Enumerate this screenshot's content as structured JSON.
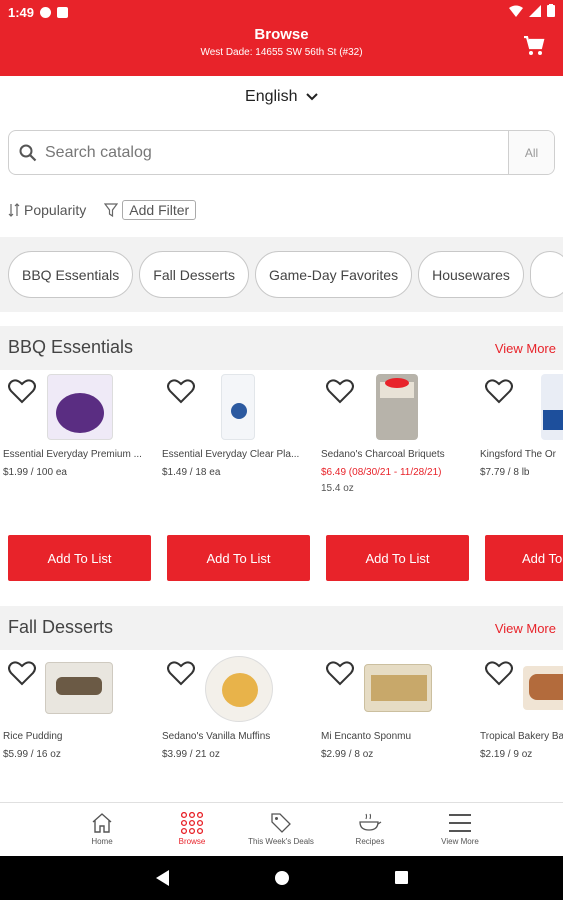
{
  "status": {
    "time": "1:49"
  },
  "header": {
    "title": "Browse",
    "store": "West Dade: 14655 SW 56th St (#32)"
  },
  "language": "English",
  "search": {
    "placeholder": "Search catalog",
    "scope": "All"
  },
  "sort": {
    "label": "Popularity"
  },
  "filter": {
    "label": "Add Filter"
  },
  "categories": [
    "BBQ Essentials",
    "Fall Desserts",
    "Game-Day Favorites",
    "Housewares",
    ""
  ],
  "sections": [
    {
      "title": "BBQ Essentials",
      "view_more": "View More",
      "products": [
        {
          "name": "Essential Everyday Premium ...",
          "price": "$1.99 / 100 ea",
          "extra": "",
          "sale": false,
          "button": "Add To List"
        },
        {
          "name": "Essential Everyday Clear Pla...",
          "price": "$1.49 / 18 ea",
          "extra": "",
          "sale": false,
          "button": "Add To List"
        },
        {
          "name": "Sedano's Charcoal Briquets",
          "price": "$6.49 (08/30/21 - 11/28/21)",
          "extra": "15.4 oz",
          "sale": true,
          "button": "Add To List"
        },
        {
          "name": "Kingsford The Or",
          "price": "$7.79 / 8 lb",
          "extra": "",
          "sale": false,
          "button": "Add To"
        }
      ]
    },
    {
      "title": "Fall Desserts",
      "view_more": "View More",
      "products": [
        {
          "name": "Rice Pudding",
          "price": "$5.99 / 16 oz",
          "sale": false
        },
        {
          "name": "Sedano's Vanilla Muffins",
          "price": "$3.99 / 21 oz",
          "sale": false
        },
        {
          "name": "Mi Encanto Sponmu",
          "price": "$2.99 / 8 oz",
          "sale": false
        },
        {
          "name": "Tropical Bakery Ba",
          "price": "$2.19 / 9 oz",
          "sale": false
        }
      ]
    }
  ],
  "bottom_nav": [
    {
      "label": "Home",
      "icon": "home-icon"
    },
    {
      "label": "Browse",
      "icon": "grid-icon",
      "active": true
    },
    {
      "label": "This Week's Deals",
      "icon": "tag-icon"
    },
    {
      "label": "Recipes",
      "icon": "recipe-icon"
    },
    {
      "label": "View More",
      "icon": "menu-icon"
    }
  ],
  "colors": {
    "brand": "#e8232a",
    "section_bg": "#f2f2f2"
  }
}
